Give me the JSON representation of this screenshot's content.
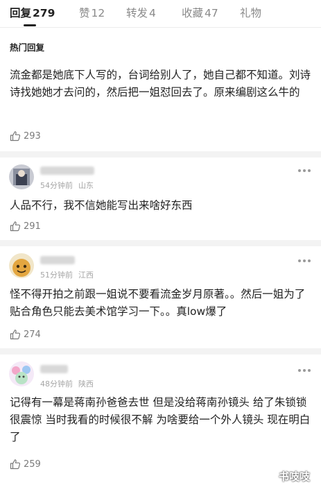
{
  "tabs": [
    {
      "label": "回复",
      "count": "279"
    },
    {
      "label": "赞",
      "count": "12"
    },
    {
      "label": "转发",
      "count": "4"
    },
    {
      "label": "收藏",
      "count": "47"
    },
    {
      "label": "礼物",
      "count": ""
    }
  ],
  "section_title": "热门回复",
  "comments": [
    {
      "text": "流金都是她底下人写的，台词给别人了，她自己都不知道。刘诗诗找她她才去问的，然后把一姐怼回去了。原来编剧这么牛的",
      "likes": "293"
    },
    {
      "time": "54分钟前",
      "location": "山东",
      "text": "人品不行，我不信她能写出来啥好东西",
      "likes": "291"
    },
    {
      "time": "51分钟前",
      "location": "江西",
      "text": "怪不得开拍之前跟一姐说不要看流金岁月原著。。然后一姐为了贴合角色只能去美术馆学习一下。。真low爆了",
      "likes": "274"
    },
    {
      "time": "48分钟前",
      "location": "陕西",
      "text": "记得有一幕是蒋南孙爸爸去世 但是没给蒋南孙镜头 给了朱锁锁很震惊  当时我看的时候很不解  为啥要给一个外人镜头  现在明白了",
      "likes": "259"
    }
  ],
  "watermark": "书吱吱",
  "icons": {
    "like": "thumbs-up-icon",
    "more": "more-dots-icon"
  },
  "colors": {
    "text": "#222222",
    "meta": "#a6a6a6",
    "divider": "#f3f3f3"
  }
}
